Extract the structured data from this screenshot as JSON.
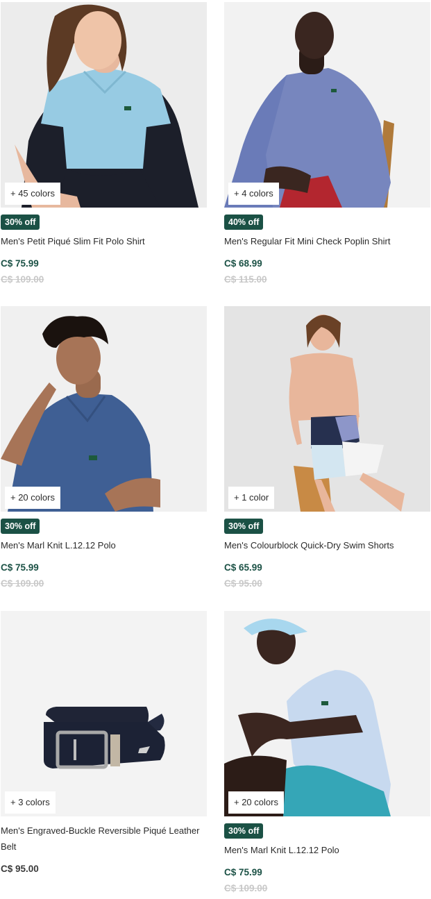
{
  "products": [
    {
      "colors": "+ 45 colors",
      "badge": "30% off",
      "name": "Men's Petit Piqué Slim Fit Polo Shirt",
      "price": "C$ 75.99",
      "old_price": "C$ 109.00"
    },
    {
      "colors": "+ 4 colors",
      "badge": "40% off",
      "name": "Men's Regular Fit Mini Check Poplin Shirt",
      "price": "C$ 68.99",
      "old_price": "C$ 115.00"
    },
    {
      "colors": "+ 20 colors",
      "badge": "30% off",
      "name": "Men's Marl Knit L.12.12 Polo",
      "price": "C$ 75.99",
      "old_price": "C$ 109.00"
    },
    {
      "colors": "+ 1 color",
      "badge": "30% off",
      "name": "Men's Colourblock Quick-Dry Swim Shorts",
      "price": "C$ 65.99",
      "old_price": "C$ 95.00"
    },
    {
      "colors": "+ 3 colors",
      "name": "Men's Engraved-Buckle Reversible Piqué Leather Belt",
      "price": "C$ 95.00"
    },
    {
      "colors": "+ 20 colors",
      "badge": "30% off",
      "name": "Men's Marl Knit L.12.12 Polo",
      "price": "C$ 75.99",
      "old_price": "C$ 109.00"
    }
  ],
  "theme": {
    "badge_color": "#1b5145",
    "price_color": "#1b5145",
    "old_price_color": "#c8c8c8"
  }
}
